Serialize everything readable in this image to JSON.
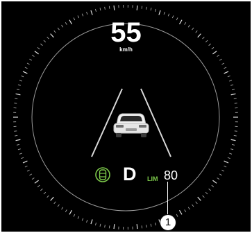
{
  "display": {
    "speed_value": "55",
    "speed_unit": "km/h",
    "gear": "D",
    "speed_limit_label": "LIM",
    "speed_limit_value": "80",
    "callout_number": "1"
  },
  "icons": {
    "vehicle": "car-rear-view-icon",
    "assist": "lane-assist-icon"
  },
  "colors": {
    "background": "#000000",
    "text": "#ffffff",
    "limit_accent": "#7cc84a",
    "assist_icon": "#7cc84a"
  }
}
